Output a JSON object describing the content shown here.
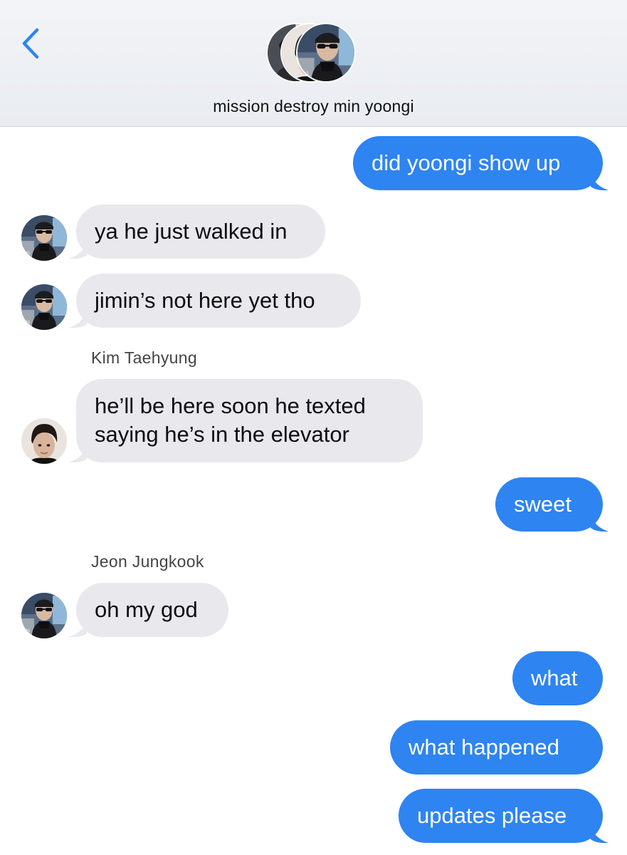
{
  "header": {
    "title": "mission destroy min yoongi",
    "back_icon": "chevron-left-icon",
    "accent_color": "#2e84f1"
  },
  "messages": [
    {
      "direction": "outgoing",
      "text": "did yoongi show up"
    },
    {
      "direction": "incoming",
      "text": "ya he just walked in"
    },
    {
      "direction": "incoming",
      "text": "jimin’s not here yet tho"
    },
    {
      "direction": "incoming",
      "sender": "Kim Taehyung",
      "lines": [
        "he’ll be here soon he texted",
        "saying he’s in the elevator"
      ]
    },
    {
      "direction": "outgoing",
      "text": "sweet"
    },
    {
      "direction": "incoming",
      "sender": "Jeon Jungkook",
      "text": "oh my god"
    },
    {
      "direction": "outgoing",
      "text": "what"
    },
    {
      "direction": "outgoing",
      "text": "what happened"
    },
    {
      "direction": "outgoing",
      "text": "updates please"
    }
  ],
  "colors": {
    "outgoing_bubble": "#2e84f1",
    "incoming_bubble": "#e8e8ed"
  }
}
